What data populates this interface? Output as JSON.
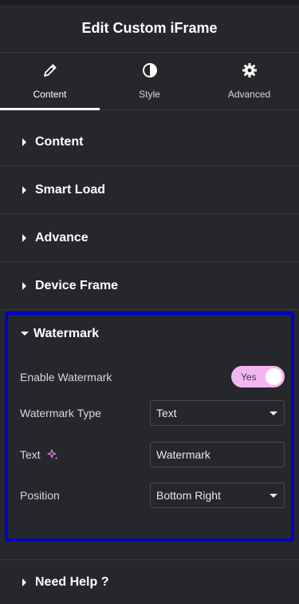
{
  "header": {
    "title": "Edit Custom iFrame"
  },
  "tabs": [
    {
      "label": "Content",
      "icon": "pencil-icon"
    },
    {
      "label": "Style",
      "icon": "half-circle-icon"
    },
    {
      "label": "Advanced",
      "icon": "gear-icon"
    }
  ],
  "sections": [
    {
      "label": "Content"
    },
    {
      "label": "Smart Load"
    },
    {
      "label": "Advance"
    },
    {
      "label": "Device Frame"
    }
  ],
  "watermark": {
    "label": "Watermark",
    "enable_label": "Enable Watermark",
    "toggle_text": "Yes",
    "type_label": "Watermark Type",
    "type_value": "Text",
    "text_label": "Text",
    "text_value": "Watermark",
    "position_label": "Position",
    "position_value": "Bottom Right"
  },
  "help": {
    "label": "Need Help ?"
  },
  "colors": {
    "background": "#26272b",
    "toggle_on": "#f3b6f1",
    "highlight_border": "#0000cc",
    "ai_icon": "#e27bd9"
  }
}
